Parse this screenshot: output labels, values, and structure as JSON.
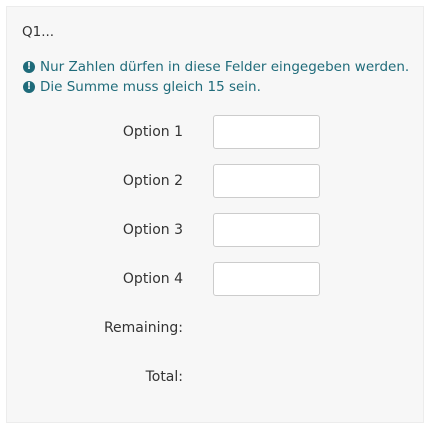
{
  "question": {
    "title": "Q1..."
  },
  "tips": [
    {
      "icon": "info-icon",
      "text": "Nur Zahlen dürfen in diese Felder eingegeben werden."
    },
    {
      "icon": "info-icon",
      "text": "Die Summe muss gleich 15 sein."
    }
  ],
  "options": [
    {
      "label": "Option 1",
      "value": ""
    },
    {
      "label": "Option 2",
      "value": ""
    },
    {
      "label": "Option 3",
      "value": ""
    },
    {
      "label": "Option 4",
      "value": ""
    }
  ],
  "summary": {
    "remaining_label": "Remaining:",
    "remaining_value": "",
    "total_label": "Total:",
    "total_value": ""
  },
  "colors": {
    "panel_background": "#f7f7f7",
    "tip_text": "#1f6b7a",
    "input_border": "#cccccc"
  }
}
